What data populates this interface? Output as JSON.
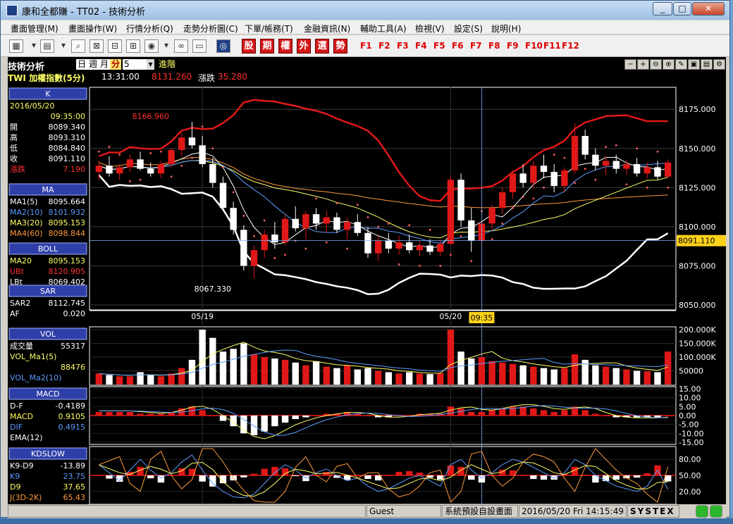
{
  "window": {
    "title": "康和全都賺 - TT02 - 技術分析",
    "app_icon": "app-logo-icon"
  },
  "menu": [
    "畫面管理(M)",
    "畫面操作(W)",
    "行情分析(Q)",
    "走勢分析圖(C)",
    "下單/帳務(T)",
    "金融資訊(N)",
    "輔助工具(A)",
    "檢視(V)",
    "設定(S)",
    "說明(H)"
  ],
  "toolbar": {
    "kana_buttons": [
      "股",
      "期",
      "權",
      "外",
      "選",
      "勢"
    ],
    "fkeys": [
      "F1",
      "F2",
      "F3",
      "F4",
      "F5",
      "F6",
      "F7",
      "F8",
      "F9",
      "F10",
      "F11",
      "F12"
    ]
  },
  "chart_header": {
    "label": "技術分析",
    "period_tabs": [
      "日",
      "週",
      "月",
      "分"
    ],
    "active_period": "分",
    "period_value": "5",
    "advanced": "進階",
    "symbol": "TWI  加權指數(5分)",
    "time": "13:31:00",
    "price": "8131.260",
    "change_label": "漲跌",
    "change": "35.280"
  },
  "panels": {
    "k": {
      "title": "K",
      "date": "2016/05/20",
      "time": "09:35:00",
      "rows": [
        {
          "label": "開",
          "value": "8089.340",
          "color": "#ffffff"
        },
        {
          "label": "高",
          "value": "8093.310",
          "color": "#ffffff"
        },
        {
          "label": "低",
          "value": "8084.840",
          "color": "#ffffff"
        },
        {
          "label": "收",
          "value": "8091.110",
          "color": "#ffffff"
        },
        {
          "label": "漲跌",
          "value": "7.190",
          "color": "#ff3030"
        }
      ]
    },
    "ma": {
      "title": "MA",
      "rows": [
        {
          "label": "MA1(5)",
          "value": "8095.664",
          "color": "#ffffff"
        },
        {
          "label": "MA2(10)",
          "value": "8101.932",
          "color": "#5d9bff"
        },
        {
          "label": "MA3(20)",
          "value": "8095.153",
          "color": "#ffff66"
        },
        {
          "label": "MA4(60)",
          "value": "8098.844",
          "color": "#ff9a3c"
        }
      ]
    },
    "boll": {
      "title": "BOLL",
      "rows": [
        {
          "label": "MA20",
          "value": "8095.153",
          "color": "#ffff66"
        },
        {
          "label": "UBt",
          "value": "8120.905",
          "color": "#ff3030"
        },
        {
          "label": "LBt",
          "value": "8069.402",
          "color": "#ffffff"
        }
      ]
    },
    "sar": {
      "title": "SAR",
      "rows": [
        {
          "label": "SAR2",
          "value": "8112.745",
          "color": "#ffffff"
        },
        {
          "label": "AF",
          "value": "0.020",
          "color": "#ffffff"
        }
      ]
    },
    "vol": {
      "title": "VOL",
      "rows": [
        {
          "label": "成交量",
          "value": "55317",
          "color": "#ffffff"
        },
        {
          "label": "VOL_Ma1(5)",
          "value": "",
          "color": "#ffff66"
        },
        {
          "label": "",
          "value": "88476",
          "color": "#ffff66"
        },
        {
          "label": "VOL_Ma2(10)",
          "value": "",
          "color": "#5d9bff"
        }
      ]
    },
    "macd": {
      "title": "MACD",
      "rows": [
        {
          "label": "D-F",
          "value": "-0.4189",
          "color": "#ffffff"
        },
        {
          "label": "MACD",
          "value": "0.9105",
          "color": "#ffff66"
        },
        {
          "label": "DIF",
          "value": "0.4915",
          "color": "#5d9bff"
        },
        {
          "label": "EMA(12)",
          "value": "",
          "color": "#ffffff"
        }
      ]
    },
    "kd": {
      "title": "KDSLOW",
      "rows": [
        {
          "label": "K9-D9",
          "value": "-13.89",
          "color": "#ffffff"
        },
        {
          "label": "K9",
          "value": "23.75",
          "color": "#5d9bff"
        },
        {
          "label": "D9",
          "value": "37.65",
          "color": "#ffff66"
        },
        {
          "label": "J(3D-2K)",
          "value": "65.43",
          "color": "#ff9a3c"
        }
      ]
    }
  },
  "price_axis": [
    "8175.000",
    "8150.000",
    "8125.000",
    "8100.000",
    "8075.000",
    "8050.000"
  ],
  "price_current": "8091.110",
  "annot_high": "8166.960",
  "annot_low": "8067.330",
  "date_axis": [
    "05/19",
    "05/20"
  ],
  "cursor_time": "09:35",
  "vol_axis": [
    "200.000K",
    "150.000K",
    "100.000K",
    "50000"
  ],
  "macd_axis": [
    "15.00",
    "10.00",
    "5.00",
    "0.00",
    "-5.00",
    "-10.00",
    "-15.00"
  ],
  "kd_axis": [
    "80.00",
    "50.00",
    "20.00"
  ],
  "statusbar": {
    "user": "Guest",
    "page": "系統預設自設畫面",
    "datetime": "2016/05/20 Fri 14:15:49",
    "brand": "SYSTEX"
  },
  "chart_data": {
    "type": "candlestick",
    "price_range": [
      8050,
      8185
    ],
    "vol_range": [
      0,
      200000
    ],
    "macd_range": [
      -15,
      15
    ],
    "kd_range": [
      0,
      100
    ],
    "candles": [
      {
        "o": 8135,
        "h": 8142,
        "l": 8130,
        "c": 8139
      },
      {
        "o": 8139,
        "h": 8145,
        "l": 8132,
        "c": 8134
      },
      {
        "o": 8134,
        "h": 8140,
        "l": 8130,
        "c": 8138
      },
      {
        "o": 8138,
        "h": 8146,
        "l": 8135,
        "c": 8143
      },
      {
        "o": 8143,
        "h": 8148,
        "l": 8136,
        "c": 8137
      },
      {
        "o": 8137,
        "h": 8141,
        "l": 8132,
        "c": 8134
      },
      {
        "o": 8134,
        "h": 8142,
        "l": 8131,
        "c": 8140
      },
      {
        "o": 8140,
        "h": 8150,
        "l": 8138,
        "c": 8149
      },
      {
        "o": 8149,
        "h": 8160,
        "l": 8145,
        "c": 8157
      },
      {
        "o": 8157,
        "h": 8167,
        "l": 8150,
        "c": 8152
      },
      {
        "o": 8152,
        "h": 8158,
        "l": 8138,
        "c": 8140
      },
      {
        "o": 8140,
        "h": 8144,
        "l": 8125,
        "c": 8128
      },
      {
        "o": 8128,
        "h": 8132,
        "l": 8110,
        "c": 8112
      },
      {
        "o": 8112,
        "h": 8116,
        "l": 8095,
        "c": 8098
      },
      {
        "o": 8098,
        "h": 8101,
        "l": 8072,
        "c": 8075
      },
      {
        "o": 8075,
        "h": 8088,
        "l": 8067,
        "c": 8085
      },
      {
        "o": 8085,
        "h": 8098,
        "l": 8080,
        "c": 8095
      },
      {
        "o": 8095,
        "h": 8103,
        "l": 8086,
        "c": 8090
      },
      {
        "o": 8090,
        "h": 8108,
        "l": 8088,
        "c": 8105
      },
      {
        "o": 8105,
        "h": 8113,
        "l": 8097,
        "c": 8099
      },
      {
        "o": 8099,
        "h": 8110,
        "l": 8092,
        "c": 8108
      },
      {
        "o": 8108,
        "h": 8112,
        "l": 8098,
        "c": 8102
      },
      {
        "o": 8102,
        "h": 8110,
        "l": 8096,
        "c": 8106
      },
      {
        "o": 8106,
        "h": 8109,
        "l": 8096,
        "c": 8098
      },
      {
        "o": 8098,
        "h": 8106,
        "l": 8092,
        "c": 8103
      },
      {
        "o": 8103,
        "h": 8108,
        "l": 8094,
        "c": 8096
      },
      {
        "o": 8096,
        "h": 8100,
        "l": 8080,
        "c": 8083
      },
      {
        "o": 8083,
        "h": 8094,
        "l": 8078,
        "c": 8091
      },
      {
        "o": 8091,
        "h": 8096,
        "l": 8083,
        "c": 8086
      },
      {
        "o": 8086,
        "h": 8094,
        "l": 8082,
        "c": 8090
      },
      {
        "o": 8090,
        "h": 8095,
        "l": 8083,
        "c": 8085
      },
      {
        "o": 8085,
        "h": 8091,
        "l": 8081,
        "c": 8088
      },
      {
        "o": 8088,
        "h": 8092,
        "l": 8082,
        "c": 8084
      },
      {
        "o": 8084,
        "h": 8091,
        "l": 8081,
        "c": 8089
      },
      {
        "o": 8089,
        "h": 8133,
        "l": 8088,
        "c": 8130
      },
      {
        "o": 8130,
        "h": 8134,
        "l": 8100,
        "c": 8104
      },
      {
        "o": 8104,
        "h": 8112,
        "l": 8084,
        "c": 8091
      },
      {
        "o": 8091,
        "h": 8104,
        "l": 8088,
        "c": 8102
      },
      {
        "o": 8102,
        "h": 8114,
        "l": 8098,
        "c": 8112
      },
      {
        "o": 8112,
        "h": 8125,
        "l": 8108,
        "c": 8122
      },
      {
        "o": 8122,
        "h": 8136,
        "l": 8118,
        "c": 8134
      },
      {
        "o": 8134,
        "h": 8140,
        "l": 8125,
        "c": 8128
      },
      {
        "o": 8128,
        "h": 8142,
        "l": 8124,
        "c": 8139
      },
      {
        "o": 8139,
        "h": 8146,
        "l": 8131,
        "c": 8135
      },
      {
        "o": 8135,
        "h": 8140,
        "l": 8122,
        "c": 8126
      },
      {
        "o": 8126,
        "h": 8138,
        "l": 8122,
        "c": 8136
      },
      {
        "o": 8136,
        "h": 8166,
        "l": 8134,
        "c": 8158
      },
      {
        "o": 8158,
        "h": 8162,
        "l": 8143,
        "c": 8146
      },
      {
        "o": 8146,
        "h": 8150,
        "l": 8136,
        "c": 8139
      },
      {
        "o": 8139,
        "h": 8145,
        "l": 8133,
        "c": 8142
      },
      {
        "o": 8142,
        "h": 8146,
        "l": 8134,
        "c": 8137
      },
      {
        "o": 8137,
        "h": 8143,
        "l": 8133,
        "c": 8140
      },
      {
        "o": 8140,
        "h": 8144,
        "l": 8132,
        "c": 8134
      },
      {
        "o": 8134,
        "h": 8141,
        "l": 8131,
        "c": 8138
      },
      {
        "o": 8138,
        "h": 8142,
        "l": 8130,
        "c": 8132
      },
      {
        "o": 8132,
        "h": 8143,
        "l": 8131,
        "c": 8141
      }
    ],
    "volume": [
      40,
      35,
      30,
      30,
      45,
      35,
      30,
      40,
      60,
      90,
      200,
      170,
      120,
      130,
      150,
      110,
      100,
      95,
      90,
      80,
      70,
      85,
      65,
      60,
      70,
      55,
      60,
      50,
      45,
      40,
      45,
      40,
      38,
      42,
      200,
      120,
      95,
      100,
      85,
      80,
      75,
      70,
      65,
      60,
      55,
      60,
      110,
      90,
      70,
      65,
      60,
      55,
      50,
      48,
      45,
      120
    ],
    "macd_hist": [
      2,
      2,
      2,
      2,
      1,
      1,
      1,
      2,
      4,
      5,
      3,
      0,
      -3,
      -6,
      -10,
      -11,
      -9,
      -6,
      -4,
      -2,
      -1,
      0,
      1,
      1,
      2,
      1,
      0,
      -1,
      -1,
      0,
      0,
      1,
      1,
      1,
      5,
      4,
      2,
      2,
      3,
      4,
      5,
      5,
      4,
      3,
      2,
      3,
      5,
      3,
      1,
      0,
      -1,
      -1,
      -1,
      -1,
      -1,
      0
    ],
    "kd_k": [
      70,
      55,
      40,
      60,
      80,
      60,
      45,
      55,
      75,
      88,
      60,
      35,
      20,
      10,
      8,
      15,
      35,
      55,
      70,
      60,
      45,
      55,
      62,
      50,
      40,
      45,
      30,
      20,
      25,
      35,
      45,
      50,
      40,
      30,
      70,
      80,
      60,
      45,
      55,
      70,
      80,
      75,
      65,
      55,
      45,
      55,
      80,
      70,
      50,
      40,
      30,
      25,
      20,
      30,
      60,
      24
    ]
  }
}
